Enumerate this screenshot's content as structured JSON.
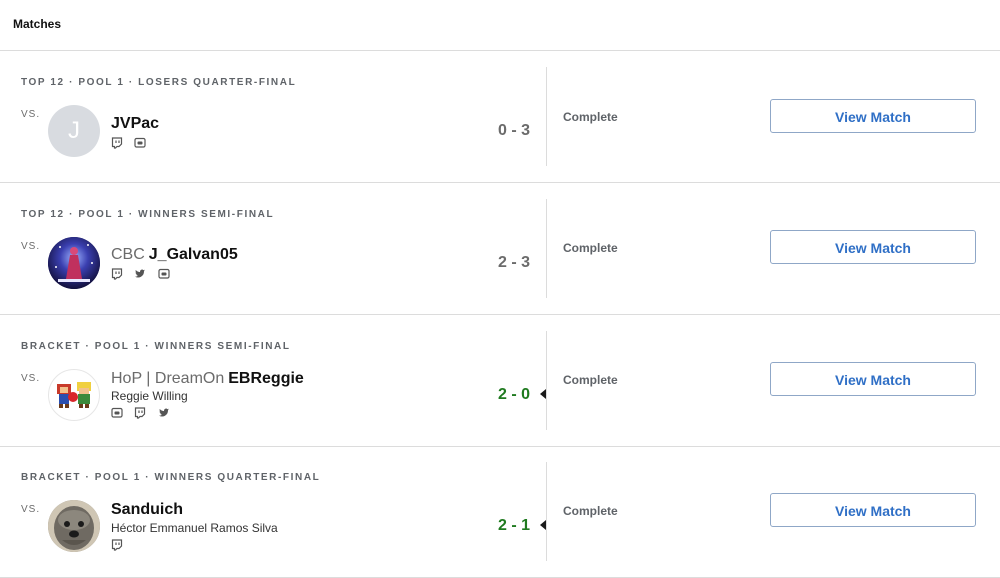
{
  "header": {
    "title": "Matches"
  },
  "matches": [
    {
      "round": "TOP 12 · POOL 1 · LOSERS QUARTER-FINAL",
      "vs": "VS.",
      "avatar_letter": "J",
      "prefix": "",
      "name": "JVPac",
      "real_name": "",
      "socials": [
        "twitch-icon",
        "discord-icon"
      ],
      "score": "0 - 3",
      "won": false,
      "status": "Complete",
      "button": "View Match"
    },
    {
      "round": "TOP 12 · POOL 1 · WINNERS SEMI-FINAL",
      "vs": "VS.",
      "avatar_letter": "",
      "prefix": "CBC",
      "name": "J_Galvan05",
      "real_name": "",
      "socials": [
        "twitch-icon",
        "twitter-icon",
        "discord-icon"
      ],
      "score": "2 - 3",
      "won": false,
      "status": "Complete",
      "button": "View Match"
    },
    {
      "round": "BRACKET · POOL 1 · WINNERS SEMI-FINAL",
      "vs": "VS.",
      "avatar_letter": "",
      "prefix": "HoP | DreamOn",
      "name": "EBReggie",
      "real_name": "Reggie Willing",
      "socials": [
        "discord-icon",
        "twitch-icon",
        "twitter-icon"
      ],
      "score": "2 - 0",
      "won": true,
      "status": "Complete",
      "button": "View Match"
    },
    {
      "round": "BRACKET · POOL 1 · WINNERS QUARTER-FINAL",
      "vs": "VS.",
      "avatar_letter": "",
      "prefix": "",
      "name": "Sanduich",
      "real_name": "Héctor Emmanuel Ramos Silva",
      "socials": [
        "twitch-icon"
      ],
      "score": "2 - 1",
      "won": true,
      "status": "Complete",
      "button": "View Match"
    }
  ],
  "colors": {
    "accent": "#2f6fc6",
    "win": "#1f7a1f",
    "muted": "#6b6b6b",
    "border": "#dcdcdc"
  }
}
